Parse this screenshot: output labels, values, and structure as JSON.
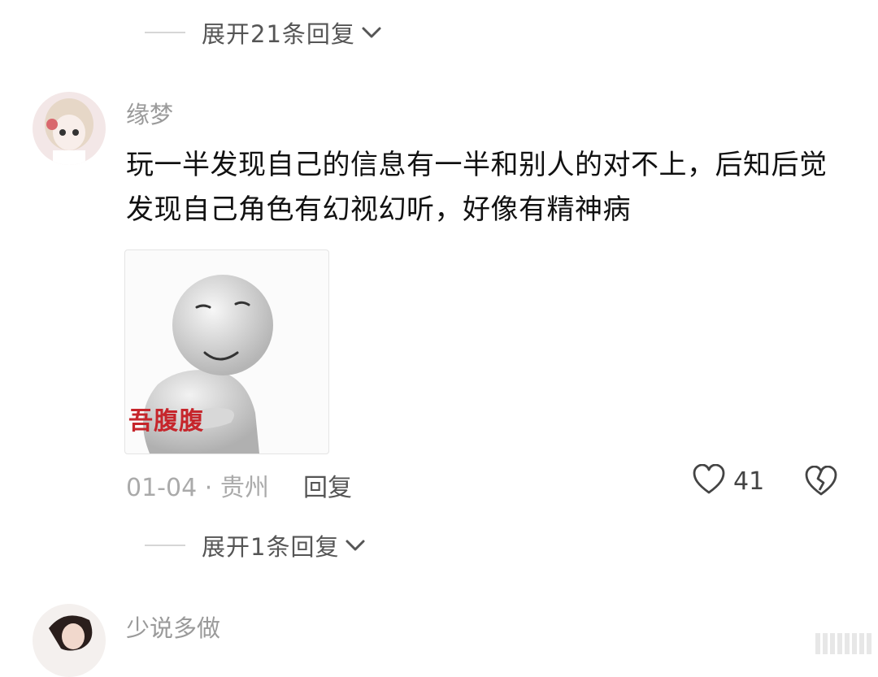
{
  "top_expand": {
    "label": "展开21条回复"
  },
  "comment": {
    "username": "缘梦",
    "text": "玩一半发现自己的信息有一半和别人的对不上，后知后觉发现自己角色有幻视幻听，好像有精神病",
    "image_caption": "吾腹腹",
    "date": "01-04",
    "separator": "·",
    "location": "贵州",
    "reply_label": "回复",
    "likes": "41"
  },
  "bottom_expand": {
    "label": "展开1条回复"
  },
  "next_comment": {
    "username": "少说多做"
  },
  "colors": {
    "text": "#111111",
    "muted": "#9a9a9a",
    "caption_red": "#c6252b"
  }
}
